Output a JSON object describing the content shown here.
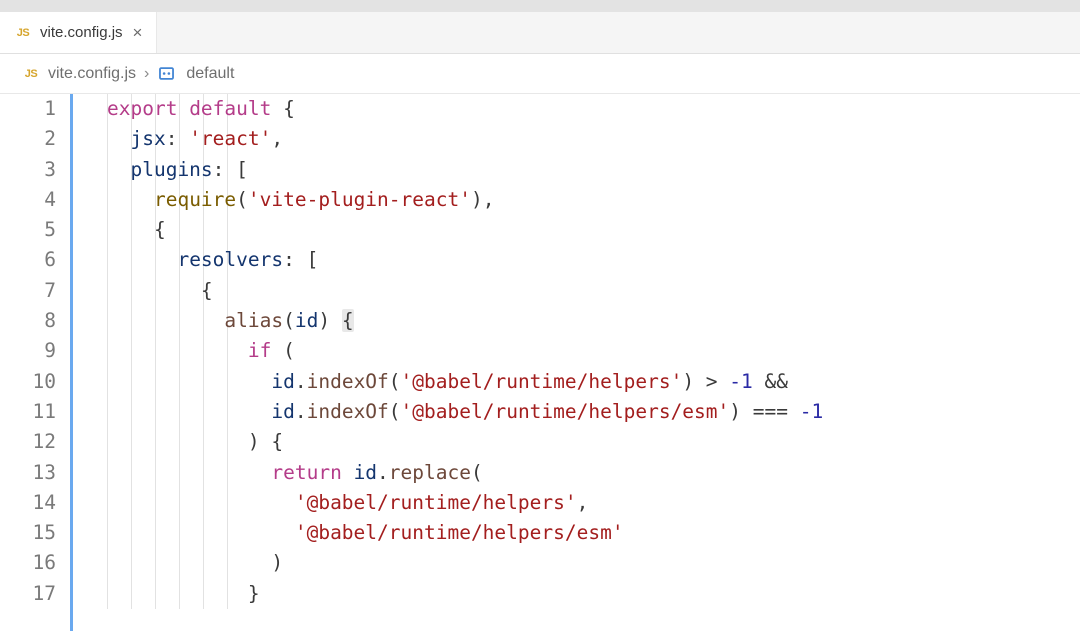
{
  "tab": {
    "filename": "vite.config.js",
    "icon_label": "JS",
    "close_glyph": "×"
  },
  "breadcrumb": {
    "file_icon_label": "JS",
    "filename": "vite.config.js",
    "separator": "›",
    "symbol_name": "default"
  },
  "colors": {
    "accent_blue": "#6aa9ef",
    "keyword": "#b43c89",
    "identifier": "#14356e",
    "string": "#a31e1e",
    "function": "#7a5c00",
    "js_icon": "#d6a52c",
    "symbol_icon": "#4285d4"
  },
  "code": {
    "total_lines": 17,
    "line_numbers": [
      "1",
      "2",
      "3",
      "4",
      "5",
      "6",
      "7",
      "8",
      "9",
      "10",
      "11",
      "12",
      "13",
      "14",
      "15",
      "16",
      "17"
    ],
    "tokens": [
      [
        {
          "t": "export ",
          "c": "kw-export"
        },
        {
          "t": "default ",
          "c": "kw-default"
        },
        {
          "t": "{",
          "c": "brace"
        }
      ],
      [
        {
          "t": "  ",
          "c": ""
        },
        {
          "t": "jsx",
          "c": "prop"
        },
        {
          "t": ": ",
          "c": "punct"
        },
        {
          "t": "'react'",
          "c": "str"
        },
        {
          "t": ",",
          "c": "punct"
        }
      ],
      [
        {
          "t": "  ",
          "c": ""
        },
        {
          "t": "plugins",
          "c": "prop"
        },
        {
          "t": ": [",
          "c": "punct"
        }
      ],
      [
        {
          "t": "    ",
          "c": ""
        },
        {
          "t": "require",
          "c": "func"
        },
        {
          "t": "(",
          "c": "punct"
        },
        {
          "t": "'vite-plugin-react'",
          "c": "str"
        },
        {
          "t": "),",
          "c": "punct"
        }
      ],
      [
        {
          "t": "    {",
          "c": "brace"
        }
      ],
      [
        {
          "t": "      ",
          "c": ""
        },
        {
          "t": "resolvers",
          "c": "prop"
        },
        {
          "t": ": [",
          "c": "punct"
        }
      ],
      [
        {
          "t": "        {",
          "c": "brace"
        }
      ],
      [
        {
          "t": "          ",
          "c": ""
        },
        {
          "t": "alias",
          "c": "call"
        },
        {
          "t": "(",
          "c": "punct"
        },
        {
          "t": "id",
          "c": "ident"
        },
        {
          "t": ") ",
          "c": "punct"
        },
        {
          "t": "{",
          "c": "brace bracket-hl"
        }
      ],
      [
        {
          "t": "            ",
          "c": ""
        },
        {
          "t": "if ",
          "c": "kw-if"
        },
        {
          "t": "(",
          "c": "punct"
        }
      ],
      [
        {
          "t": "              ",
          "c": ""
        },
        {
          "t": "id",
          "c": "ident"
        },
        {
          "t": ".",
          "c": "punct"
        },
        {
          "t": "indexOf",
          "c": "call"
        },
        {
          "t": "(",
          "c": "punct"
        },
        {
          "t": "'@babel/runtime/helpers'",
          "c": "str"
        },
        {
          "t": ") > ",
          "c": "op"
        },
        {
          "t": "-1",
          "c": "num"
        },
        {
          "t": " &&",
          "c": "op"
        }
      ],
      [
        {
          "t": "              ",
          "c": ""
        },
        {
          "t": "id",
          "c": "ident"
        },
        {
          "t": ".",
          "c": "punct"
        },
        {
          "t": "indexOf",
          "c": "call"
        },
        {
          "t": "(",
          "c": "punct"
        },
        {
          "t": "'@babel/runtime/helpers/esm'",
          "c": "str"
        },
        {
          "t": ") === ",
          "c": "op"
        },
        {
          "t": "-1",
          "c": "num"
        }
      ],
      [
        {
          "t": "            ) {",
          "c": "punct"
        }
      ],
      [
        {
          "t": "              ",
          "c": ""
        },
        {
          "t": "return ",
          "c": "kw-return"
        },
        {
          "t": "id",
          "c": "ident"
        },
        {
          "t": ".",
          "c": "punct"
        },
        {
          "t": "replace",
          "c": "call"
        },
        {
          "t": "(",
          "c": "punct"
        }
      ],
      [
        {
          "t": "                ",
          "c": ""
        },
        {
          "t": "'@babel/runtime/helpers'",
          "c": "str"
        },
        {
          "t": ",",
          "c": "punct"
        }
      ],
      [
        {
          "t": "                ",
          "c": ""
        },
        {
          "t": "'@babel/runtime/helpers/esm'",
          "c": "str"
        }
      ],
      [
        {
          "t": "              )",
          "c": "punct"
        }
      ],
      [
        {
          "t": "            }",
          "c": "brace"
        }
      ]
    ]
  }
}
